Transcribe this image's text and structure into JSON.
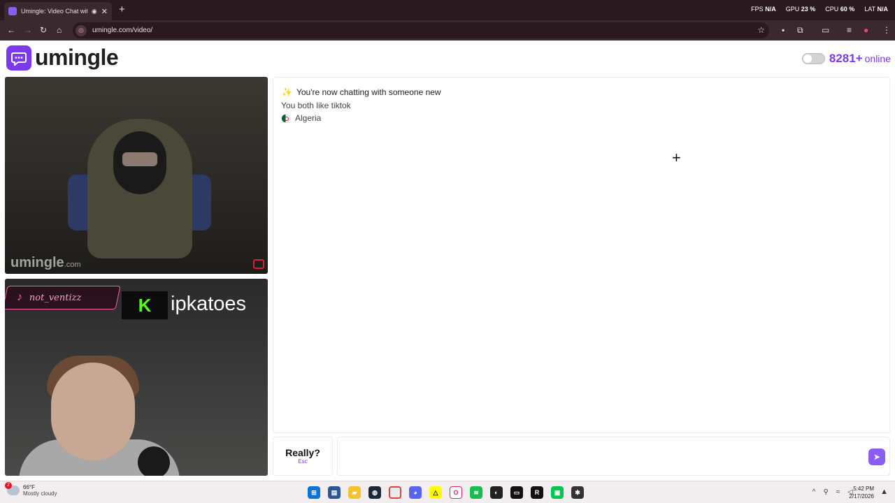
{
  "browser": {
    "tab_title": "Umingle: Video Chat with S",
    "new_tab": "+",
    "url": "umingle.com/video/",
    "stats": [
      {
        "label": "FPS",
        "value": "N/A"
      },
      {
        "label": "GPU",
        "value": "23 %"
      },
      {
        "label": "CPU",
        "value": "60 %"
      },
      {
        "label": "LAT",
        "value": "N/A"
      }
    ]
  },
  "header": {
    "logo_text": "umingle",
    "online_count": "8281+",
    "online_word": "online",
    "toggle_state": "off"
  },
  "videos": {
    "stranger_watermark": "umingle",
    "stranger_watermark_suffix": ".com",
    "self_tiktok_handle": "not_ventizz",
    "self_kick_logo": "K",
    "self_kick_name": "ipkatoes"
  },
  "chat": {
    "intro": "You're now chatting with someone new",
    "common_interest": "You both like tiktok",
    "country": "Algeria"
  },
  "controls": {
    "skip_label": "Really?",
    "skip_hint": "Esc",
    "message_placeholder": "",
    "send_icon": "send-icon"
  },
  "taskbar": {
    "weather_temp": "66°F",
    "weather_cond": "Mostly cloudy",
    "weather_badge": "2",
    "time": "5:42 PM",
    "date": "2/17/2026"
  },
  "colors": {
    "brand": "#7c3aed",
    "chrome_dark": "#2a1a1f",
    "chrome_toolbar": "#3b2930"
  }
}
